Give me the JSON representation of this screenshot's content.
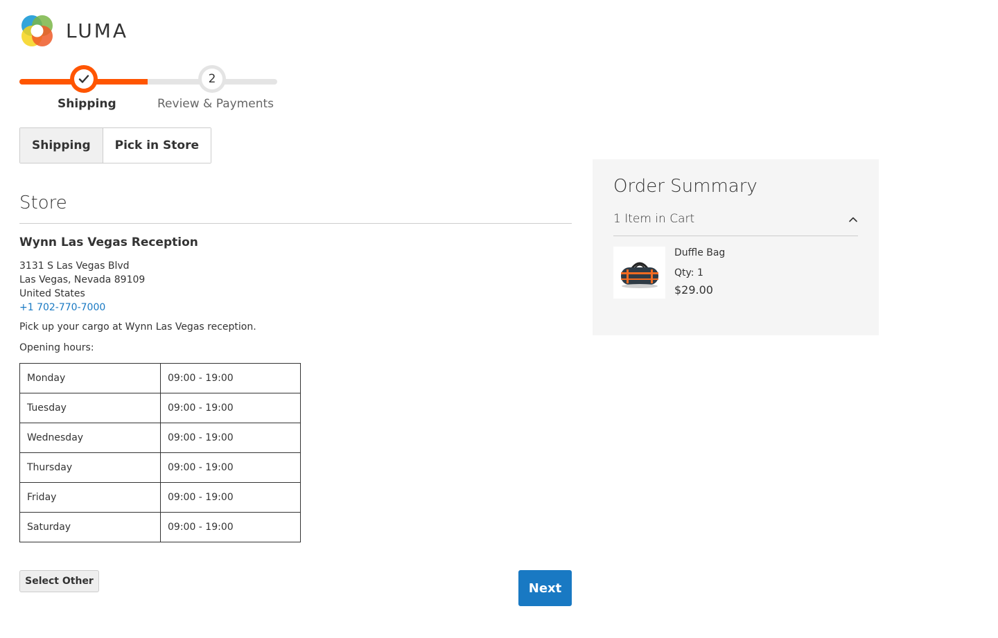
{
  "brand": {
    "name": "LUMA"
  },
  "progress": {
    "steps": [
      {
        "number": "1",
        "label": "Shipping",
        "state": "complete"
      },
      {
        "number": "2",
        "label": "Review & Payments",
        "state": "pending"
      }
    ],
    "accent_color": "#ff5501"
  },
  "tabs": [
    {
      "label": "Shipping",
      "active": true
    },
    {
      "label": "Pick in Store",
      "active": false
    }
  ],
  "store": {
    "section_title": "Store",
    "name": "Wynn Las Vegas Reception",
    "address_line1": "3131 S Las Vegas Blvd",
    "address_line2": "Las Vegas, Nevada 89109",
    "country": "United States",
    "phone": "+1 702-770-7000",
    "note": "Pick up your cargo at Wynn Las Vegas reception.",
    "hours_label": "Opening hours:",
    "hours": [
      {
        "day": "Monday",
        "time": "09:00 - 19:00"
      },
      {
        "day": "Tuesday",
        "time": "09:00 - 19:00"
      },
      {
        "day": "Wednesday",
        "time": "09:00 - 19:00"
      },
      {
        "day": "Thursday",
        "time": "09:00 - 19:00"
      },
      {
        "day": "Friday",
        "time": "09:00 - 19:00"
      },
      {
        "day": "Saturday",
        "time": "09:00 - 19:00"
      }
    ]
  },
  "actions": {
    "select_other_label": "Select Other",
    "next_label": "Next",
    "primary_color": "#1979c3"
  },
  "order_summary": {
    "title": "Order Summary",
    "items_in_cart": "1 Item in Cart",
    "toggle_icon": "chevron-up-icon",
    "items": [
      {
        "name": "Duffle Bag",
        "qty": "Qty: 1",
        "price": "$29.00",
        "image_icon": "duffle-bag-image"
      }
    ]
  }
}
